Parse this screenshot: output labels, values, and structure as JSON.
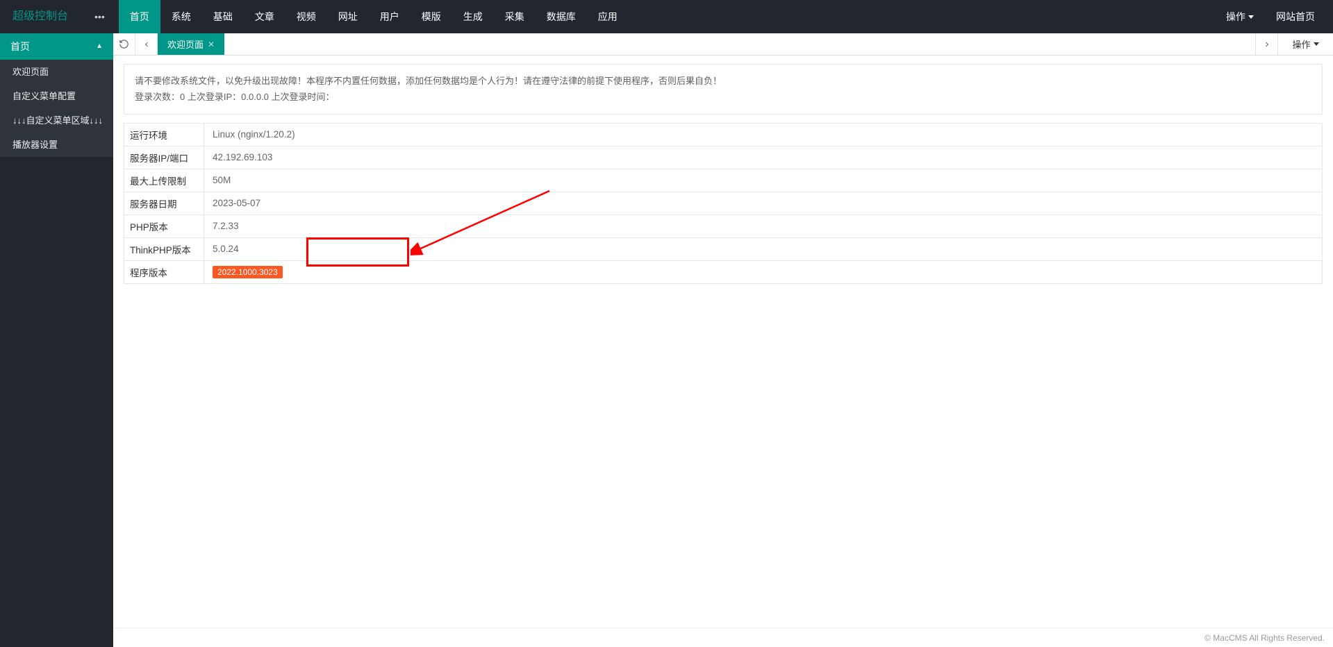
{
  "header": {
    "logo": "超级控制台",
    "nav": [
      "首页",
      "系统",
      "基础",
      "文章",
      "视频",
      "网址",
      "用户",
      "模版",
      "生成",
      "采集",
      "数据库",
      "应用"
    ],
    "active_nav_index": 0,
    "right": {
      "action_label": "操作",
      "site_home_label": "网站首页"
    }
  },
  "sidebar": {
    "title": "首页",
    "items": [
      "欢迎页面",
      "自定义菜单配置",
      "↓↓↓自定义菜单区域↓↓↓",
      "播放器设置"
    ]
  },
  "tabs": {
    "active_tab_label": "欢迎页面",
    "right_action_label": "操作"
  },
  "notice": {
    "line1": "请不要修改系统文件，以免升级出现故障！本程序不内置任何数据，添加任何数据均是个人行为！请在遵守法律的前提下使用程序，否则后果自负！",
    "line2_prefix": "登录次数：",
    "login_count": "0",
    "last_ip_label": " 上次登录IP：",
    "last_ip": "0.0.0.0",
    "last_time_label": " 上次登录时间：",
    "last_time": ""
  },
  "info": {
    "rows": [
      {
        "label": "运行环境",
        "value": "Linux (nginx/1.20.2)"
      },
      {
        "label": "服务器IP/端口",
        "value": "42.192.69.103"
      },
      {
        "label": "最大上传限制",
        "value": "50M"
      },
      {
        "label": "服务器日期",
        "value": "2023-05-07"
      },
      {
        "label": "PHP版本",
        "value": "7.2.33"
      },
      {
        "label": "ThinkPHP版本",
        "value": "5.0.24"
      },
      {
        "label": "程序版本",
        "value": "2022.1000.3023",
        "badge": true
      }
    ]
  },
  "footer": {
    "copyright": "© MacCMS All Rights Reserved."
  }
}
